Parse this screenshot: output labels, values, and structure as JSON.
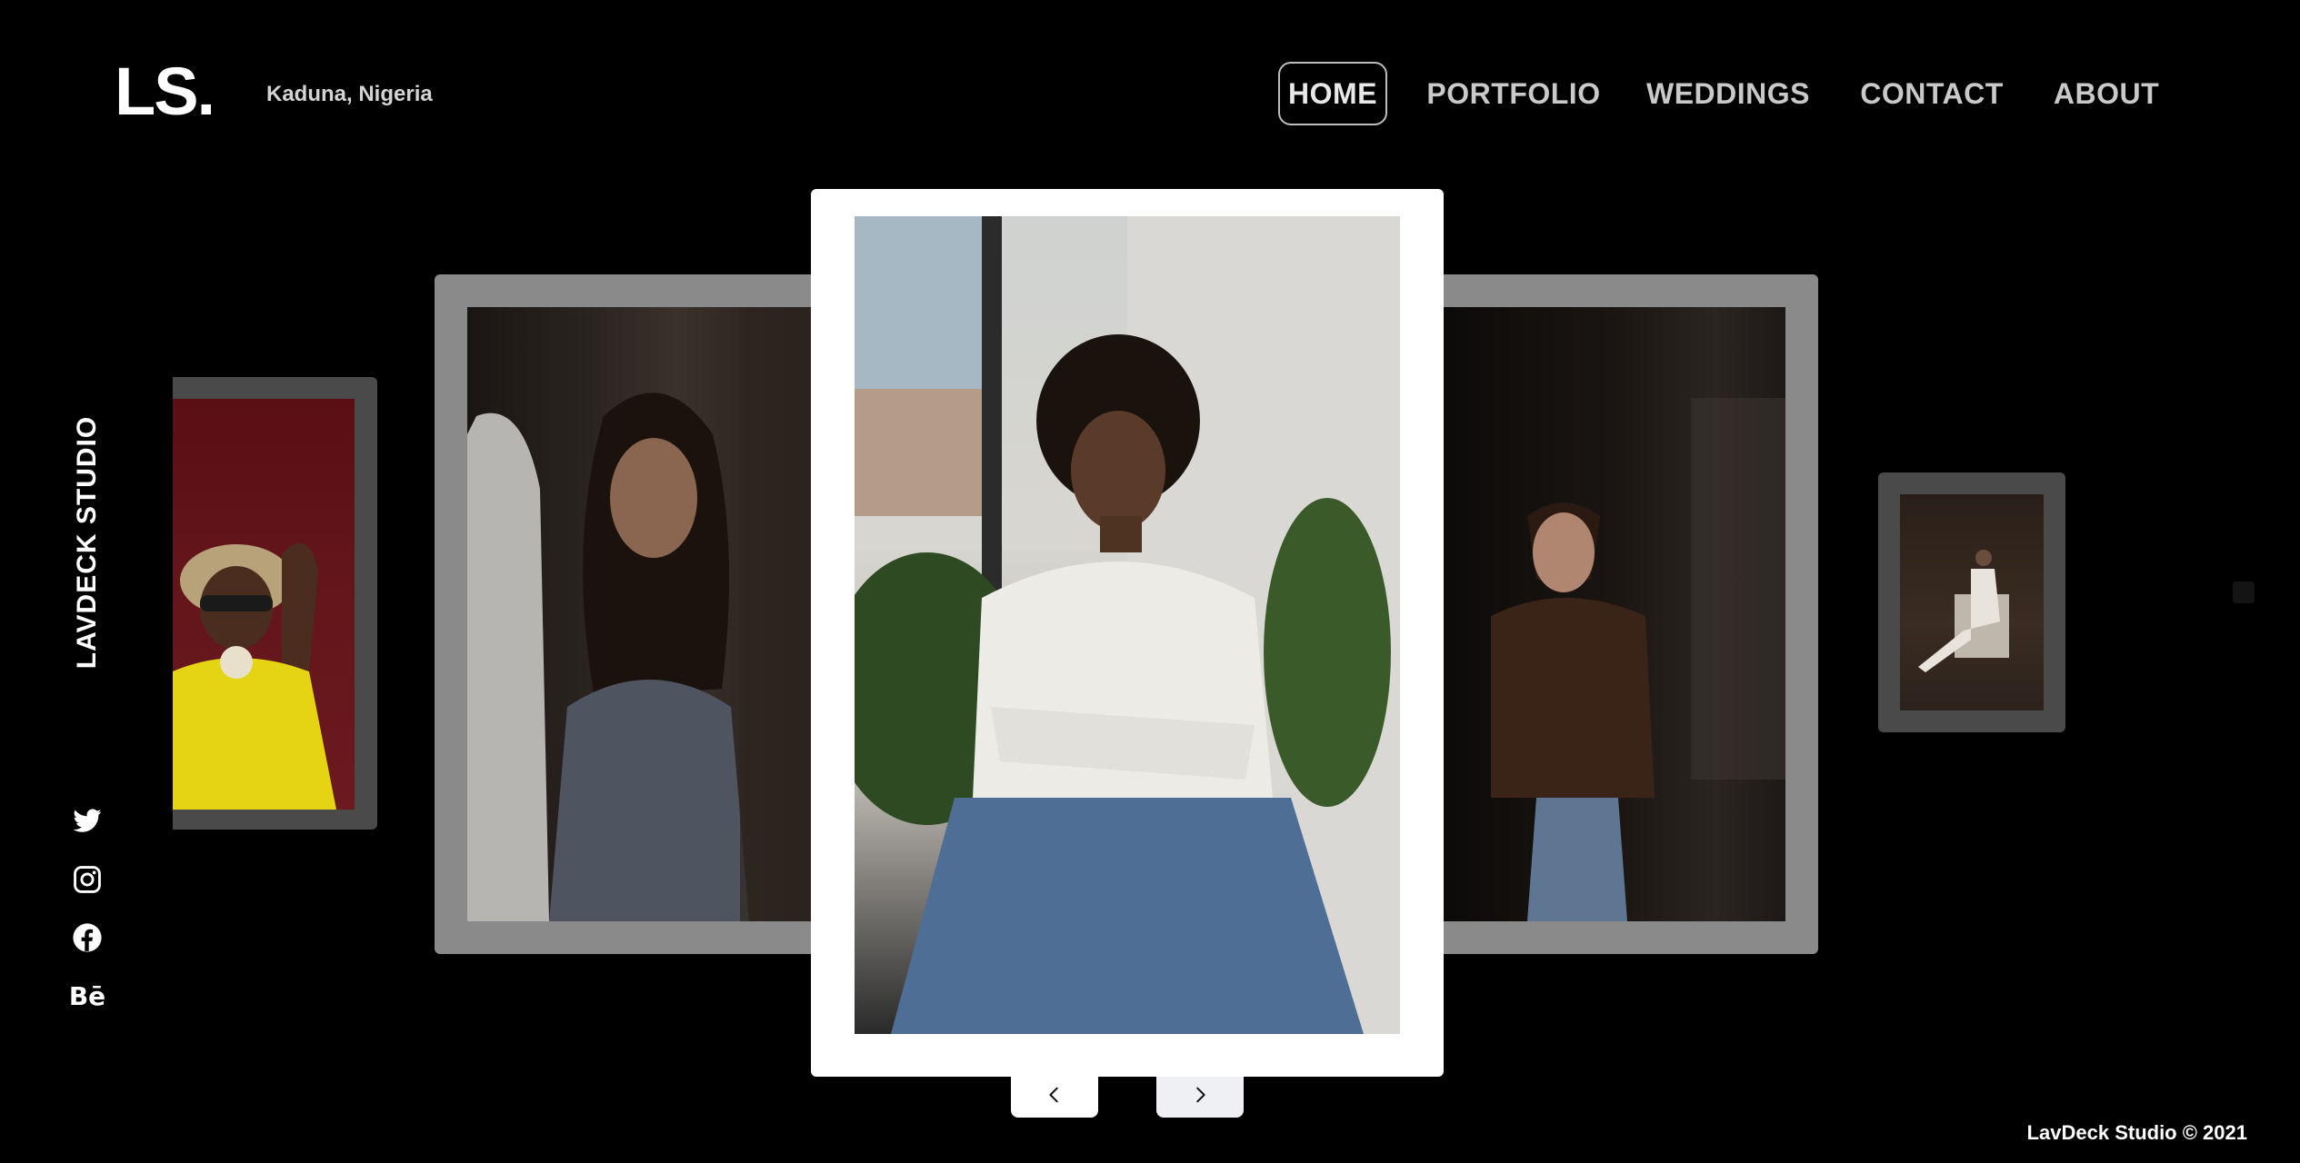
{
  "header": {
    "logo": "LS.",
    "location": "Kaduna, Nigeria"
  },
  "nav": {
    "items": [
      {
        "label": "HOME",
        "active": true
      },
      {
        "label": "PORTFOLIO",
        "active": false
      },
      {
        "label": "WEDDINGS",
        "active": false
      },
      {
        "label": "CONTACT",
        "active": false
      },
      {
        "label": "ABOUT",
        "active": false
      }
    ]
  },
  "sidebar": {
    "brand": "LAVDECK STUDIO",
    "social": [
      {
        "icon": "twitter-icon"
      },
      {
        "icon": "instagram-icon"
      },
      {
        "icon": "facebook-icon"
      },
      {
        "icon": "behance-icon",
        "text": "Bē"
      }
    ]
  },
  "carousel": {
    "slides": [
      {
        "position": "far-left",
        "subject": "person in yellow outfit with wide hat on red background"
      },
      {
        "position": "left",
        "subject": "woman with long dark hair in low light"
      },
      {
        "position": "center",
        "subject": "woman in white turtleneck and jeans by window with plant"
      },
      {
        "position": "right",
        "subject": "woman in velvet top and jeans in shadowed room"
      },
      {
        "position": "far-right",
        "subject": "person seated in white outfit on chair"
      }
    ],
    "prev_symbol": "‹",
    "next_symbol": "›"
  },
  "footer": {
    "copyright": "LavDeck Studio © 2021"
  }
}
